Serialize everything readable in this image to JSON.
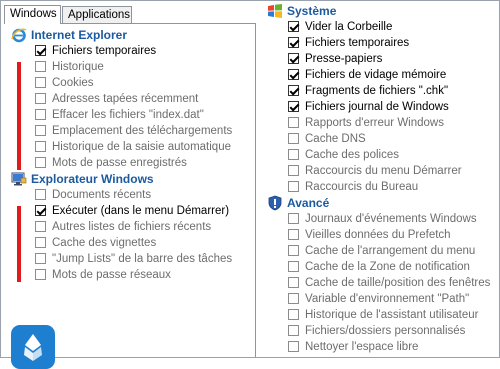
{
  "tabs": [
    {
      "label": "Windows",
      "active": true
    },
    {
      "label": "Applications",
      "active": false
    }
  ],
  "left": {
    "sections": [
      {
        "title": "Internet Explorer",
        "icon": "internet-explorer-icon",
        "items": [
          {
            "label": "Fichiers temporaires",
            "checked": true
          },
          {
            "label": "Historique",
            "checked": false
          },
          {
            "label": "Cookies",
            "checked": false
          },
          {
            "label": "Adresses tapées récemment",
            "checked": false
          },
          {
            "label": "Effacer les fichiers \"index.dat\"",
            "checked": false
          },
          {
            "label": "Emplacement des téléchargements",
            "checked": false
          },
          {
            "label": "Historique de la saisie automatique",
            "checked": false
          },
          {
            "label": "Mots de passe enregistrés",
            "checked": false
          }
        ]
      },
      {
        "title": "Explorateur Windows",
        "icon": "windows-explorer-icon",
        "items": [
          {
            "label": "Documents récents",
            "checked": false
          },
          {
            "label": "Exécuter (dans le menu Démarrer)",
            "checked": true
          },
          {
            "label": "Autres listes de fichiers récents",
            "checked": false
          },
          {
            "label": "Cache des vignettes",
            "checked": false
          },
          {
            "label": "\"Jump Lists\" de la barre des tâches",
            "checked": false
          },
          {
            "label": "Mots de passe réseaux",
            "checked": false
          }
        ]
      }
    ]
  },
  "right": {
    "sections": [
      {
        "title": "Système",
        "icon": "windows-logo-icon",
        "items": [
          {
            "label": "Vider la Corbeille",
            "checked": true
          },
          {
            "label": "Fichiers temporaires",
            "checked": true
          },
          {
            "label": "Presse-papiers",
            "checked": true
          },
          {
            "label": "Fichiers de vidage mémoire",
            "checked": true
          },
          {
            "label": "Fragments de fichiers \".chk\"",
            "checked": true
          },
          {
            "label": "Fichiers journal de Windows",
            "checked": true
          },
          {
            "label": "Rapports d'erreur Windows",
            "checked": false
          },
          {
            "label": "Cache DNS",
            "checked": false
          },
          {
            "label": "Cache des polices",
            "checked": false
          },
          {
            "label": "Raccourcis du menu Démarrer",
            "checked": false
          },
          {
            "label": "Raccourcis du Bureau",
            "checked": false
          }
        ]
      },
      {
        "title": "Avancé",
        "icon": "shield-icon",
        "items": [
          {
            "label": "Journaux d'événements Windows",
            "checked": false
          },
          {
            "label": "Vieilles données du Prefetch",
            "checked": false
          },
          {
            "label": "Cache de l'arrangement du menu",
            "checked": false
          },
          {
            "label": "Cache de la Zone de notification",
            "checked": false
          },
          {
            "label": "Cache de taille/position des fenêtres",
            "checked": false
          },
          {
            "label": "Variable d'environnement \"Path\"",
            "checked": false
          },
          {
            "label": "Historique de l'assistant utilisateur",
            "checked": false
          },
          {
            "label": "Fichiers/dossiers personnalisés",
            "checked": false
          },
          {
            "label": "Nettoyer l'espace libre",
            "checked": false
          }
        ]
      }
    ]
  },
  "colors": {
    "section_title": "#1c5a9f",
    "highlight_bar": "#e01b1b",
    "logo_bg": "#1e7fd0"
  }
}
